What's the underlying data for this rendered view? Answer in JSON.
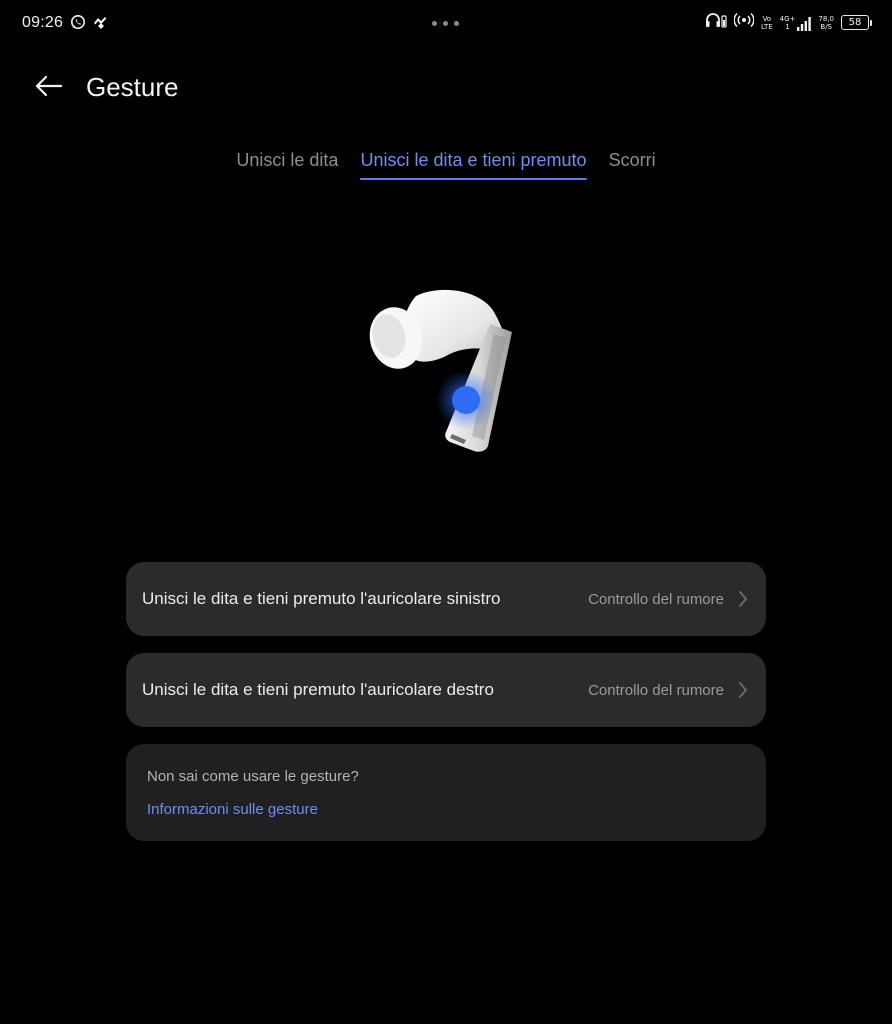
{
  "status_bar": {
    "time": "09:26",
    "left_icons": [
      "whatsapp-icon",
      "app-notification-icon"
    ],
    "right": {
      "volte_top": "Vo",
      "volte_bottom": "LTE",
      "network_top": "4G+",
      "network_bottom": "1",
      "speed_top": "78,0",
      "speed_bottom": "B/S",
      "battery": "58"
    }
  },
  "header": {
    "title": "Gesture"
  },
  "tabs": [
    {
      "label": "Unisci le dita",
      "active": false
    },
    {
      "label": "Unisci le dita e tieni premuto",
      "active": true
    },
    {
      "label": "Scorri",
      "active": false
    }
  ],
  "rows": [
    {
      "label": "Unisci le dita e tieni premuto l'auricolare sinistro",
      "value": "Controllo del rumore"
    },
    {
      "label": "Unisci le dita e tieni premuto l'auricolare destro",
      "value": "Controllo del rumore"
    }
  ],
  "help": {
    "question": "Non sai come usare le gesture?",
    "link": "Informazioni sulle gesture"
  },
  "colors": {
    "background": "#000000",
    "accent": "#6f8df5",
    "card": "#2b2b2b",
    "touch_point": "#2f6cf6"
  }
}
